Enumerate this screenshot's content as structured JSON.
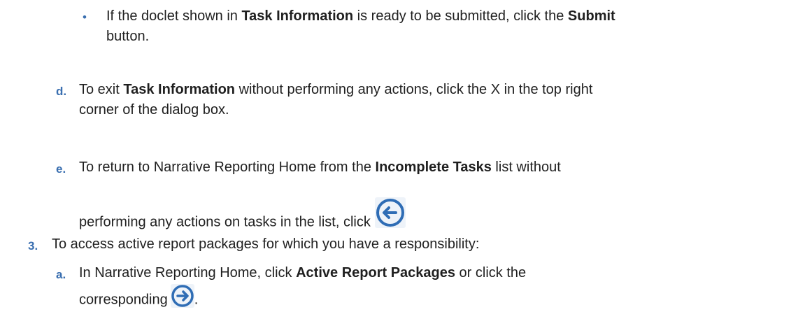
{
  "items": {
    "bullet": {
      "marker": "•",
      "pre": "If the doclet shown in ",
      "b1": "Task Information",
      "mid": " is ready to be submitted, click the ",
      "b2": "Submit",
      "post_line1_end": "",
      "line2": "button."
    },
    "d": {
      "marker": "d.",
      "pre": "To exit ",
      "b1": "Task Information",
      "post": " without performing any actions, click the X in the top right",
      "line2": "corner of the dialog box."
    },
    "e": {
      "marker": "e.",
      "pre": "To return to Narrative Reporting Home from the ",
      "b1": "Incomplete Tasks",
      "post": " list without",
      "line2": "performing any actions on tasks in the list, click"
    },
    "three": {
      "marker": "3.",
      "text": "To access active report packages for which you have a responsibility:"
    },
    "a": {
      "marker": "a.",
      "pre": "In Narrative Reporting Home, click ",
      "b1": "Active Report Packages",
      "post": " or click the",
      "line2": "corresponding",
      "end": "."
    }
  },
  "icons": {
    "accent": "#2f6db5",
    "back": "back-arrow-circle-icon",
    "forward": "forward-arrow-circle-icon"
  }
}
